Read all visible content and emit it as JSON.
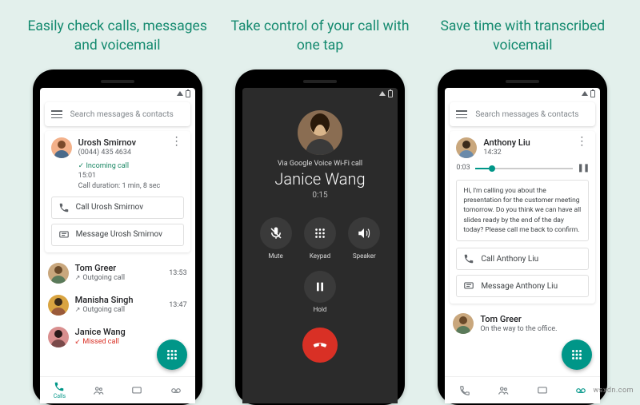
{
  "headlines": [
    "Easily check calls, messages and voicemail",
    "Take control of your call with one tap",
    "Save time with transcribed voicemail"
  ],
  "phone1": {
    "search_placeholder": "Search messages & contacts",
    "contact": {
      "name": "Urosh Smirnov",
      "number": "(0044) 435 4634",
      "status_prefix": "Incoming call",
      "time": "15:01",
      "duration_line": "Call duration: 1 min, 8 sec"
    },
    "action_call": "Call Urosh Smirnov",
    "action_message": "Message Urosh Smirnov",
    "recent": [
      {
        "name": "Tom Greer",
        "sub": "Outgoing call",
        "time": "13:53"
      },
      {
        "name": "Manisha Singh",
        "sub": "Outgoing call",
        "time": "13:47"
      },
      {
        "name": "Janice Wang",
        "sub": "Missed call",
        "time": ""
      }
    ],
    "tabs": {
      "calls": "Calls"
    }
  },
  "phone2": {
    "via": "Via Google Voice Wi-Fi call",
    "caller": "Janice Wang",
    "duration": "0:15",
    "controls": {
      "mute": "Mute",
      "keypad": "Keypad",
      "speaker": "Speaker",
      "hold": "Hold"
    }
  },
  "phone3": {
    "search_placeholder": "Search messages & contacts",
    "vm": {
      "name": "Anthony Liu",
      "time": "14:32",
      "elapsed": "0:03",
      "transcript": "Hi, I'm calling you about the presentation for the customer meeting tomorrow. Do you think we can have all slides ready by the end of the day today? Please call me back to confirm."
    },
    "action_call": "Call Anthony Liu",
    "action_message": "Message Anthony Liu",
    "recent": {
      "name": "Tom Greer",
      "sub": "On the way to the office."
    }
  },
  "watermark": "wsxdn.com"
}
